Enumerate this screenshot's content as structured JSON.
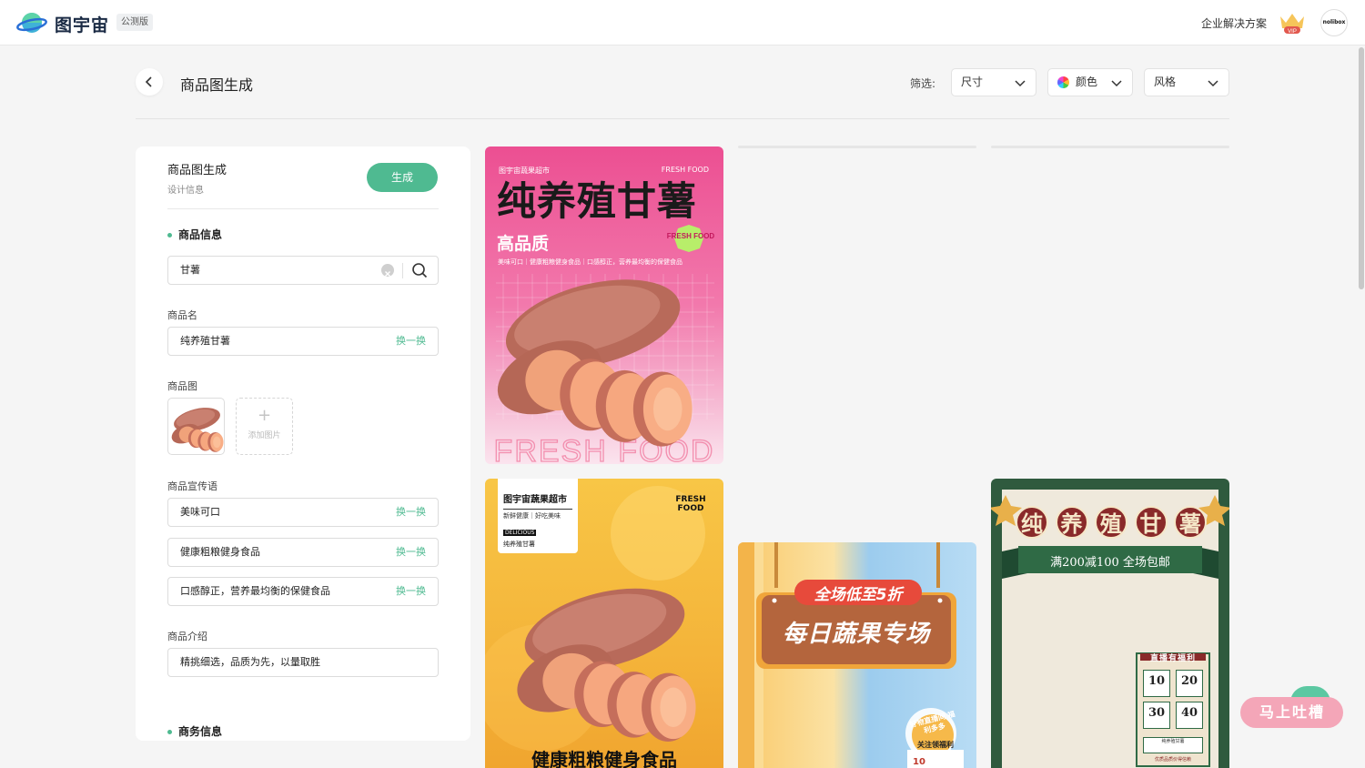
{
  "header": {
    "brand": "图宇宙",
    "beta_badge": "公测版",
    "enterprise_link": "企业解决方案",
    "vip_label": "VIP",
    "avatar_text": "nolibox"
  },
  "toolbar": {
    "page_title": "商品图生成",
    "filter_label": "筛选:",
    "filters": [
      "尺寸",
      "颜色",
      "风格"
    ]
  },
  "panel": {
    "title": "商品图生成",
    "subtitle": "设计信息",
    "generate_button": "生成",
    "product_section": "商品信息",
    "search_value": "甘薯",
    "name_label": "商品名",
    "name_value": "纯养殖甘薯",
    "swap_label": "换一换",
    "image_label": "商品图",
    "add_image_label": "添加图片",
    "slogan_label": "商品宣传语",
    "slogans": [
      "美味可口",
      "健康粗粮健身食品",
      "口感醇正，营养最均衡的保健食品"
    ],
    "intro_label": "商品介绍",
    "intro_value": "精挑细选，品质为先，以量取胜",
    "business_section": "商务信息"
  },
  "cards": {
    "pink": {
      "store": "图宇宙蔬果超市",
      "tag": "FRESH FOOD",
      "headline": "纯养殖甘薯",
      "quality": "高品质",
      "badge": "FRESH FOOD",
      "sub": "美味可口｜健康粗粮健身食品｜口感醇正，营养最均衡的保健食品",
      "watermark": "FRESH FOOD"
    },
    "orange": {
      "store": "图宇宙蔬果超市",
      "store_sub": "新鲜健康｜好吃美味",
      "delicious": "DELICIOUS",
      "product": "纯养殖甘薯",
      "tag": "FRESH FOOD",
      "bottom": "健康粗粮健身食品"
    },
    "blue": {
      "top_sign": "全场低至5折",
      "main_sign": "每日蔬果专场",
      "bubble": "好物直播间 福利多多",
      "follow": "关注领福利",
      "price": "10"
    },
    "green": {
      "title_chars": [
        "纯",
        "养",
        "殖",
        "甘",
        "薯"
      ],
      "ribbon": "满200减100 全场包邮",
      "coupon_title": "直播有福利",
      "coupons": [
        "10",
        "20",
        "30",
        "40"
      ],
      "coupon_item": "纯养殖甘薯",
      "coupon_footer": "优质品质价得信赖"
    }
  },
  "feedback_button": "马上吐槽",
  "colors": {
    "accent": "#4fba91",
    "pink": "#f0679a",
    "orange": "#f5b93a",
    "green_frame": "#2e5a3c",
    "maroon": "#8a2a2a"
  }
}
